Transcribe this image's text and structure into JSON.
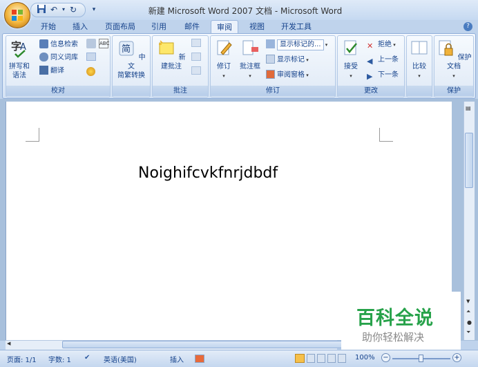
{
  "titlebar": {
    "title": "新建 Microsoft Word 2007 文档 - Microsoft Word"
  },
  "tabs": [
    "开始",
    "插入",
    "页面布局",
    "引用",
    "邮件",
    "审阅",
    "视图",
    "开发工具"
  ],
  "active_tab": "审阅",
  "groups": {
    "proofing": {
      "label": "校对",
      "spell": "拼写和\n语法",
      "research": "信息检索",
      "thesaurus": "同义词库",
      "translate": "翻译"
    },
    "chinese": {
      "label": "",
      "btn": "中文\n简繁转换"
    },
    "comments": {
      "label": "批注",
      "new_comment": "新建批注"
    },
    "tracking": {
      "label": "修订",
      "track": "修订",
      "balloons": "批注框",
      "markup_select": "显示标记的...",
      "show_markup": "显示标记",
      "review_pane": "审阅窗格"
    },
    "changes": {
      "label": "更改",
      "accept": "接受",
      "reject": "拒绝",
      "prev": "上一条",
      "next": "下一条"
    },
    "compare": {
      "label": "",
      "btn": "比较"
    },
    "protect": {
      "label": "保护",
      "btn": "保护文档"
    }
  },
  "document": {
    "text": "Noighifcvkfnrjdbdf"
  },
  "status": {
    "page": "页面: 1/1",
    "words": "字数: 1",
    "language": "英语(美国)",
    "mode": "插入",
    "zoom": "100%"
  },
  "watermark": {
    "line1": "百科全说",
    "line2": "助你轻松解决"
  }
}
